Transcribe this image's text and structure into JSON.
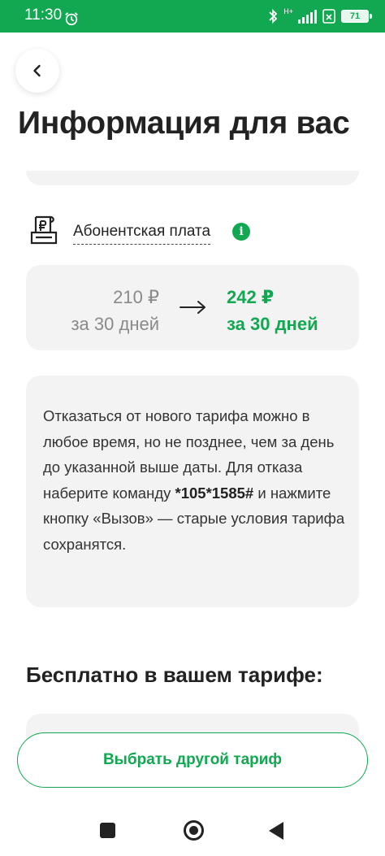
{
  "status_bar": {
    "time": "11:30",
    "network": "H+",
    "battery": "71"
  },
  "header": {
    "title": "Информация для вас"
  },
  "fee": {
    "label": "Абонентская плата",
    "info_icon_glyph": "i",
    "old_price": "210 ₽",
    "old_period": "за 30 дней",
    "new_price": "242 ₽",
    "new_period": "за 30 дней"
  },
  "notice": {
    "text_before": "Отказаться от нового тарифа можно в любое время, но не позднее, чем за день до указанной выше даты. Для отказа наберите команду ",
    "code": "*105*1585#",
    "text_after": " и нажмите кнопку «Вызов» — старые условия тарифа сохранятся."
  },
  "section": {
    "title": "Бесплатно в вашем тарифе:"
  },
  "actions": {
    "choose_label": "Выбрать другой тариф"
  },
  "icons": {
    "back": "chevron-left-icon",
    "fee": "receipt-ruble-icon",
    "info": "info-icon",
    "arrow": "arrow-right-icon"
  },
  "colors": {
    "brand_green": "#11a851",
    "card_bg": "#f3f3f3",
    "muted_text": "#8a8a8a"
  }
}
